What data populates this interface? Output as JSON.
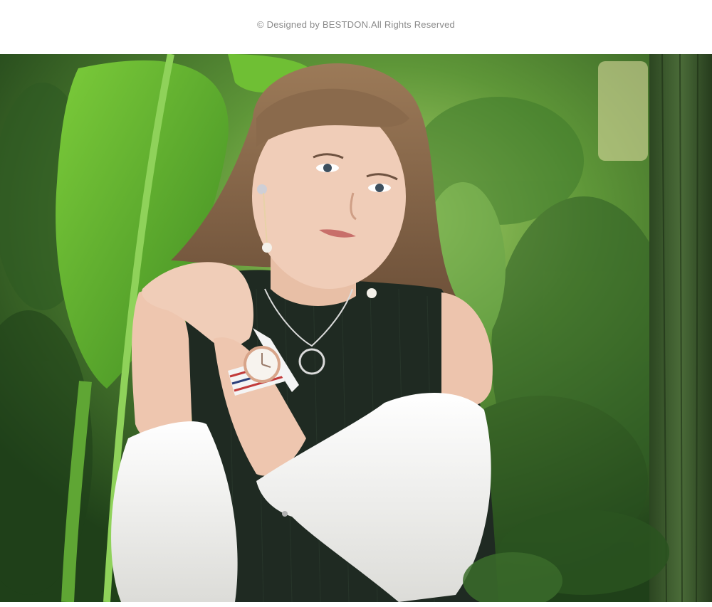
{
  "header": {
    "copyright_notice": "© Designed by BESTDON.All Rights Reserved"
  },
  "photo": {
    "subject": "woman-wearing-wristwatch",
    "colors": {
      "foliage_dark": "#22461b",
      "foliage_mid": "#3f7a2c",
      "foliage_light": "#8cc64a",
      "leaf_bright": "#62b52a",
      "sweater": "#1f2a22",
      "sleeve": "#f4f4f2",
      "skin": "#f0cdb8",
      "hair": "#8a6a4c",
      "cactus": "#3d5a2e",
      "watch_face": "#f7f3ee",
      "watch_rim": "#d8a58a"
    }
  }
}
